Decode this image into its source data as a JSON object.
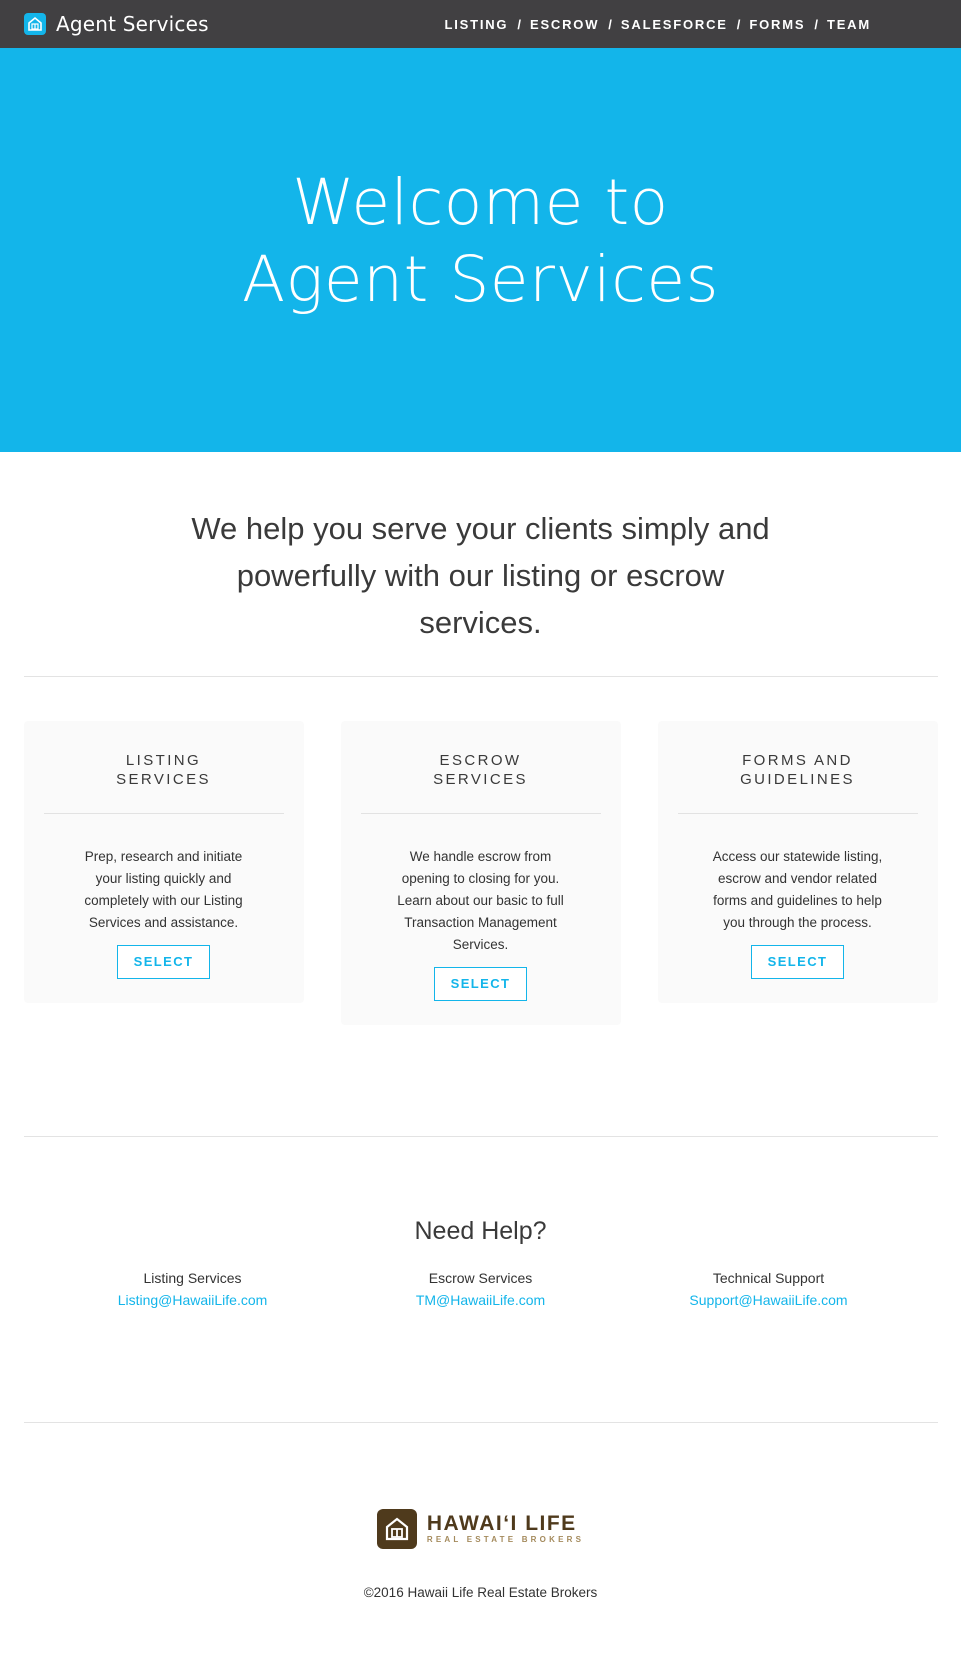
{
  "header": {
    "brand": "Agent Services",
    "nav": [
      {
        "label": "LISTING"
      },
      {
        "label": "ESCROW"
      },
      {
        "label": "SALESFORCE"
      },
      {
        "label": "FORMS"
      },
      {
        "label": "TEAM"
      }
    ],
    "separator": "/"
  },
  "hero": {
    "line1": "Welcome to",
    "line2": "Agent Services"
  },
  "intro": {
    "text": "We help you serve your clients simply and powerfully with our listing or escrow services."
  },
  "cards": [
    {
      "title": "LISTING\nSERVICES",
      "text": "Prep, research and initiate your listing quickly and completely with our Listing Services and assistance.",
      "button": "SELECT"
    },
    {
      "title": "ESCROW\nSERVICES",
      "text": "We handle escrow from opening to closing for you. Learn about our basic to full Transaction Management Services.",
      "button": "SELECT"
    },
    {
      "title": "FORMS AND\nGUIDELINES",
      "text": "Access our statewide listing, escrow and vendor related forms and guidelines to help you through the process.",
      "button": "SELECT"
    }
  ],
  "help": {
    "title": "Need Help?",
    "contacts": [
      {
        "label": "Listing Services",
        "email": "Listing@HawaiiLife.com"
      },
      {
        "label": "Escrow Services",
        "email": "TM@HawaiiLife.com"
      },
      {
        "label": "Technical Support",
        "email": "Support@HawaiiLife.com"
      }
    ]
  },
  "footer": {
    "logo_name": "HAWAIʻI LIFE",
    "logo_tagline": "REAL ESTATE BROKERS",
    "copyright": "©2016 Hawaii Life Real Estate Brokers"
  },
  "colors": {
    "accent": "#13b5ea",
    "topbar": "#414042",
    "brand_brown": "#4f3a1c"
  },
  "icons": {
    "brand": "house-icon",
    "footer_logo": "house-icon"
  }
}
